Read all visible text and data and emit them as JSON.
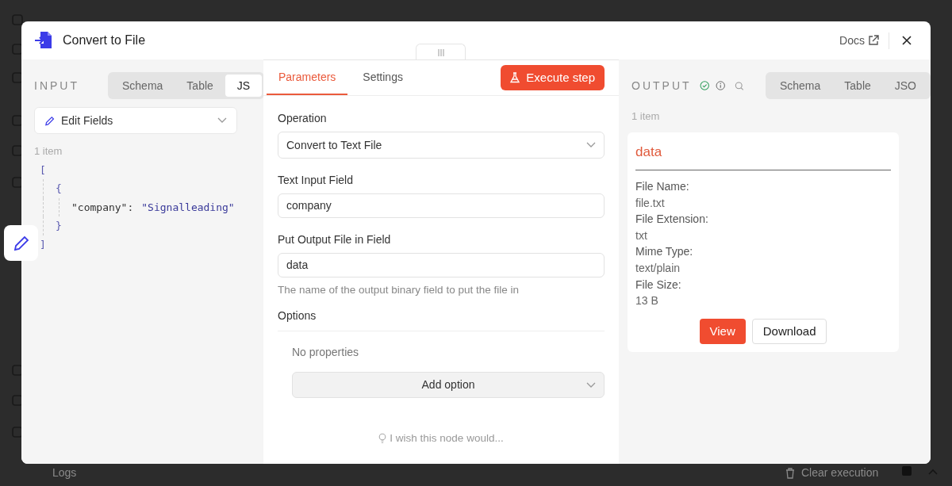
{
  "window": {
    "title": "Convert to File",
    "docs_link": "Docs"
  },
  "input_panel": {
    "label": "INPUT",
    "tabs": [
      {
        "label": "Schema",
        "selected": false
      },
      {
        "label": "Table",
        "selected": false
      },
      {
        "label": "JS",
        "selected": true
      }
    ],
    "node_select": "Edit Fields",
    "item_count": "1 item",
    "json_lines": [
      {
        "kind": "bracket",
        "text": "["
      },
      {
        "kind": "bracket",
        "text": "{"
      },
      {
        "kind": "pair",
        "key": "\"company\":",
        "value": "\"Signalleading\""
      },
      {
        "kind": "bracket",
        "text": "}"
      },
      {
        "kind": "bracket",
        "text": "]"
      }
    ]
  },
  "parameters_panel": {
    "tabs": [
      {
        "label": "Parameters",
        "selected": true
      },
      {
        "label": "Settings",
        "selected": false
      }
    ],
    "execute_button": "Execute step",
    "fields": [
      {
        "kind": "select",
        "label": "Operation",
        "value": "Convert to Text File"
      },
      {
        "kind": "input",
        "label": "Text Input Field",
        "value": "company"
      },
      {
        "kind": "input",
        "label": "Put Output File in Field",
        "value": "data",
        "hint": "The name of the output binary field to put the file in"
      }
    ],
    "options": {
      "label": "Options",
      "empty_text": "No properties",
      "add_button": "Add option"
    },
    "feedback_link": "I wish this node would..."
  },
  "output_panel": {
    "label": "OUTPUT",
    "tabs": [
      {
        "label": "Schema",
        "selected": false
      },
      {
        "label": "Table",
        "selected": false
      },
      {
        "label": "JSO",
        "selected": false
      }
    ],
    "item_count": "1 item",
    "card": {
      "title": "data",
      "fields": [
        {
          "label": "File Name:",
          "value": "file.txt"
        },
        {
          "label": "File Extension:",
          "value": "txt"
        },
        {
          "label": "Mime Type:",
          "value": "text/plain"
        },
        {
          "label": "File Size:",
          "value": "13 B"
        }
      ],
      "buttons": [
        "View",
        "Download"
      ]
    }
  },
  "background": {
    "logs_label": "Logs",
    "clear_button": "Clear execution"
  }
}
